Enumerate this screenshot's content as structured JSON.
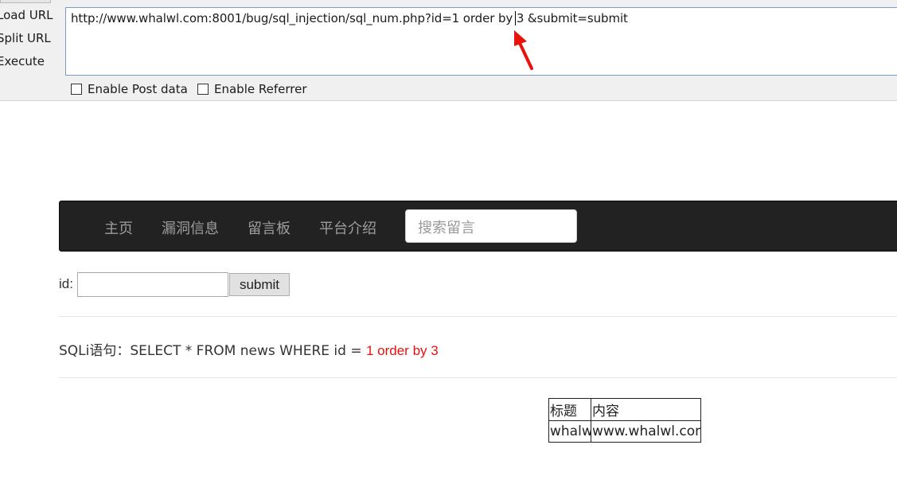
{
  "hackbar": {
    "actions": {
      "load": "Load URL",
      "split": "Split URL",
      "execute": "Execute"
    },
    "url_value": "http://www.whalwl.com:8001/bug/sql_injection/sql_num.php?id=1 order by 3 &submit=submit",
    "options": {
      "post": "Enable Post data",
      "referrer": "Enable Referrer"
    },
    "annotation_color": "#e8120c"
  },
  "nav": {
    "items": [
      "主页",
      "漏洞信息",
      "留言板",
      "平台介绍"
    ],
    "search_placeholder": "搜索留言"
  },
  "form": {
    "id_label": "id:",
    "id_value": "",
    "submit_label": "submit"
  },
  "sqli": {
    "label": "SQLi语句：SELECT * FROM news WHERE id = ",
    "injected": "1 order by 3",
    "highlight_color": "#e8120c"
  },
  "table": {
    "headers": [
      "标题",
      "内容"
    ],
    "rows": [
      [
        "whalwl",
        "www.whalwl.com."
      ]
    ]
  }
}
